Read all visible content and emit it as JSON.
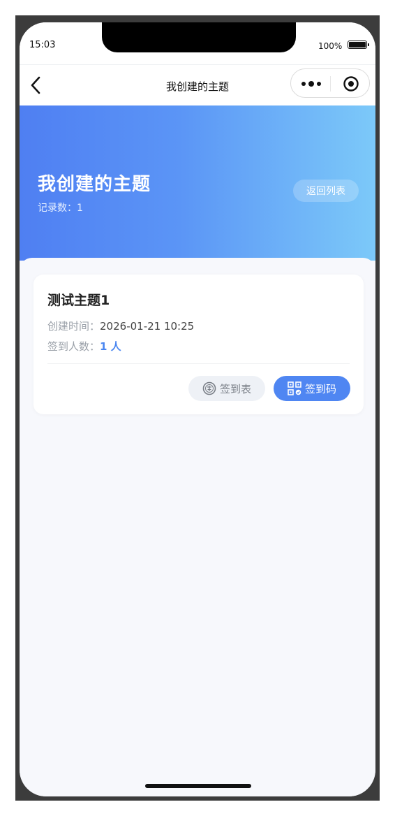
{
  "status_bar": {
    "time": "15:03",
    "battery": "100%"
  },
  "nav": {
    "title": "我创建的主题"
  },
  "header": {
    "title": "我创建的主题",
    "count_label": "记录数：",
    "count_value": "1",
    "back_to_list": "返回列表"
  },
  "topics": [
    {
      "name": "测试主题1",
      "created_label": "创建时间：",
      "created_value": "2026-01-21 10:25",
      "signin_label": "签到人数：",
      "signin_value": "1 人",
      "btn_sign_list": "签到表",
      "btn_sign_code": "签到码"
    }
  ],
  "colors": {
    "accent": "#4f86f2",
    "hero_start": "#4f7ff2",
    "hero_end": "#7cc9f9",
    "background": "#f7f8fc"
  },
  "icons": [
    "back-icon",
    "more-icon",
    "close-target-icon",
    "sign-stamp-icon",
    "qrcode-icon"
  ]
}
